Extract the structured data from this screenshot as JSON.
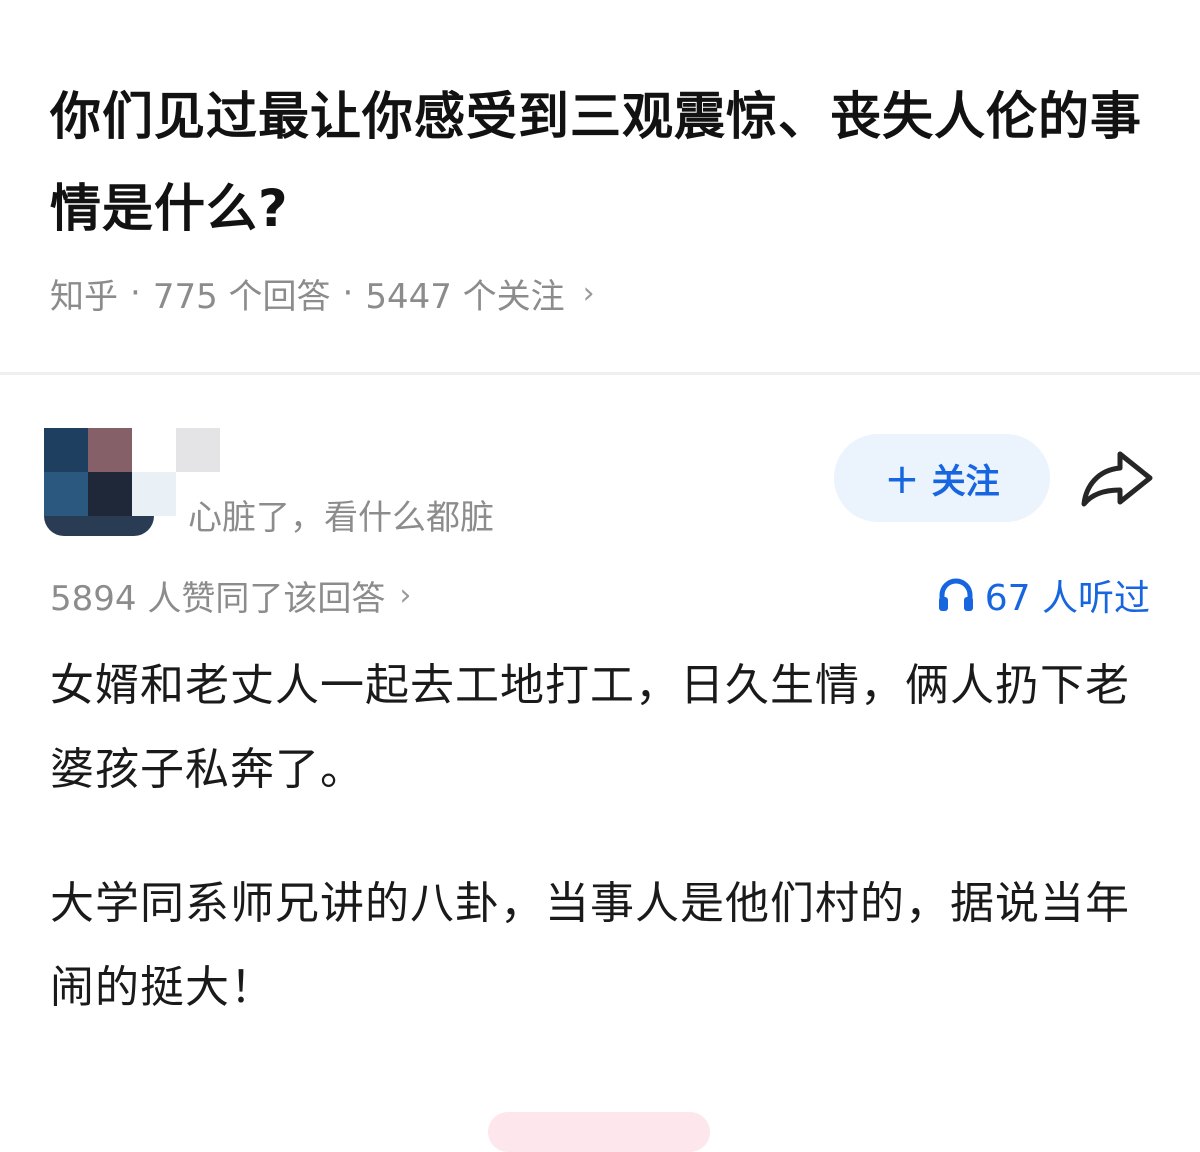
{
  "question": {
    "title": "你们见过最让你感受到三观震惊、丧失人伦的事情是什么?",
    "source": "知乎",
    "answers": "775 个回答",
    "followers": "5447 个关注",
    "dot": "·",
    "chevron": "›"
  },
  "answer": {
    "author_signature": "心脏了，看什么都脏",
    "follow_label": "关注",
    "follow_plus": "+",
    "votes_text": "5894 人赞同了该回答",
    "chevron": "›",
    "listened_text": "67 人听过",
    "paragraphs": [
      "女婿和老丈人一起去工地打工，日久生情，俩人扔下老婆孩子私奔了。",
      "大学同系师兄讲的八卦，当事人是他们村的，据说当年闹的挺大！"
    ]
  },
  "icons": {
    "share": "share-arrow-icon",
    "headphones": "headphones-icon",
    "chevron": "chevron-right-icon"
  },
  "colors": {
    "accent_blue": "#1766e0",
    "follow_bg": "#ebf3fd",
    "meta_gray": "#8c8c8c",
    "text": "#1a1a1a"
  }
}
